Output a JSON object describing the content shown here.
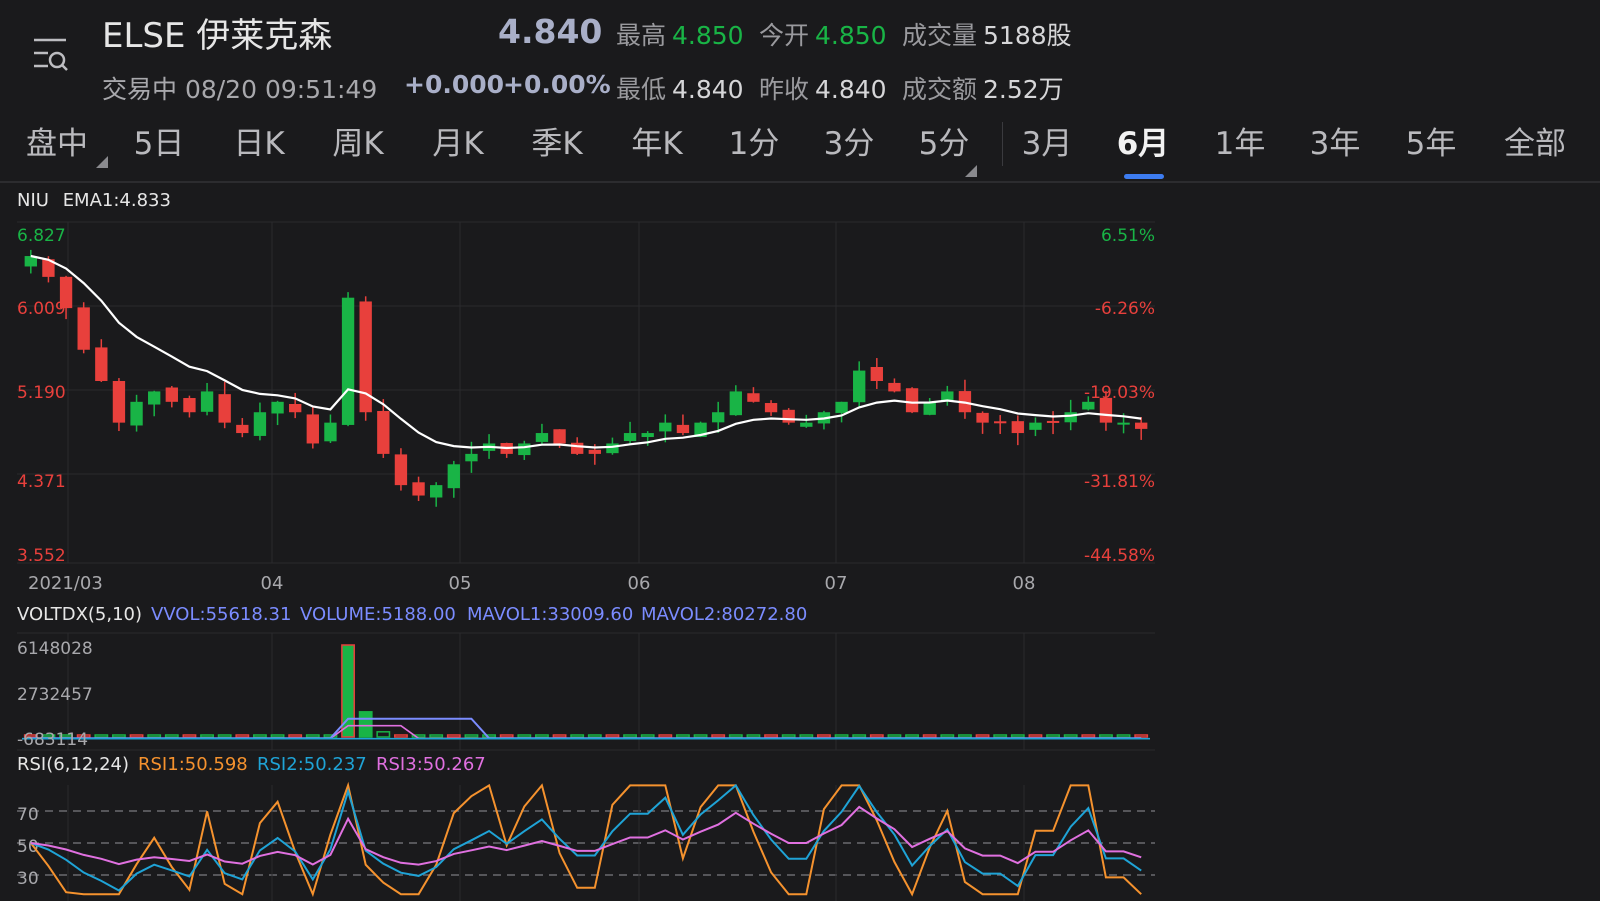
{
  "header": {
    "title": "ELSE 伊莱克森",
    "status": "交易中 08/20 09:51:49",
    "price": "4.840",
    "change": "+0.000",
    "change_pct": "+0.00%",
    "stats": {
      "high_label": "最高",
      "high_value": "4.850",
      "open_label": "今开",
      "open_value": "4.850",
      "volume_label": "成交量",
      "volume_value": "5188股",
      "low_label": "最低",
      "low_value": "4.840",
      "prev_close_label": "昨收",
      "prev_close_value": "4.840",
      "turnover_label": "成交额",
      "turnover_value": "2.52万"
    }
  },
  "tabs": [
    "盘中",
    "5日",
    "日K",
    "周K",
    "月K",
    "季K",
    "年K",
    "1分",
    "3分",
    "5分",
    "3月",
    "6月",
    "1年",
    "3年",
    "5年",
    "全部"
  ],
  "active_tab": "6月",
  "colors": {
    "up": "#19b446",
    "down": "#e8403c",
    "ema": "#ffffff",
    "accent": "#3d7cf0",
    "vvol": "#7b8cff",
    "rsi1": "#f5922e",
    "rsi2": "#1fa3d6",
    "rsi3": "#e070e0"
  },
  "main_chart": {
    "indicator_name": "NIU",
    "ema_label": "EMA1:4.833",
    "y_labels": [
      "6.827",
      "6.009",
      "5.190",
      "4.371",
      "3.552"
    ],
    "pct_labels": [
      "6.51%",
      "-6.26%",
      "-19.03%",
      "-31.81%",
      "-44.58%"
    ],
    "x_labels": [
      "2021/03",
      "04",
      "05",
      "06",
      "07",
      "08"
    ]
  },
  "volume_panel": {
    "name": "VOLTDX(5,10)",
    "vvol": "VVOL:55618.31",
    "volume": "VOLUME:5188.00",
    "mavol1": "MAVOL1:33009.60",
    "mavol2": "MAVOL2:80272.80",
    "y_labels": [
      "6148028",
      "2732457",
      "-683114"
    ]
  },
  "rsi_panel": {
    "name": "RSI(6,12,24)",
    "rsi1": "RSI1:50.598",
    "rsi2": "RSI2:50.237",
    "rsi3": "RSI3:50.267",
    "y_labels": [
      "70",
      "50",
      "30"
    ]
  },
  "chart_data": {
    "type": "candlestick",
    "symbol": "ELSE",
    "x": [
      "2021/03",
      "04",
      "05",
      "06",
      "07",
      "08"
    ],
    "ylim": [
      3.552,
      6.827
    ],
    "close_approx": [
      6.5,
      6.3,
      6.0,
      5.6,
      5.3,
      4.9,
      5.1,
      5.2,
      5.1,
      5.0,
      5.2,
      4.9,
      4.8,
      5.0,
      5.1,
      5.0,
      4.7,
      4.9,
      6.1,
      5.0,
      4.6,
      4.3,
      4.2,
      4.3,
      4.5,
      4.6,
      4.7,
      4.6,
      4.7,
      4.8,
      4.7,
      4.6,
      4.6,
      4.7,
      4.8,
      4.8,
      4.9,
      4.8,
      4.9,
      5.0,
      5.2,
      5.1,
      5.0,
      4.9,
      4.9,
      5.0,
      5.1,
      5.4,
      5.3,
      5.2,
      5.0,
      5.1,
      5.2,
      5.0,
      4.9,
      4.9,
      4.8,
      4.9,
      4.9,
      5.0,
      5.1,
      4.9,
      4.9,
      4.84
    ],
    "volume": {
      "ylim": [
        -683114,
        6148028
      ],
      "spike_month": "04",
      "spike_value": 6148028
    },
    "rsi": {
      "levels": [
        30,
        50,
        70
      ],
      "rsi1_last": 50.598,
      "rsi2_last": 50.237,
      "rsi3_last": 50.267
    }
  }
}
